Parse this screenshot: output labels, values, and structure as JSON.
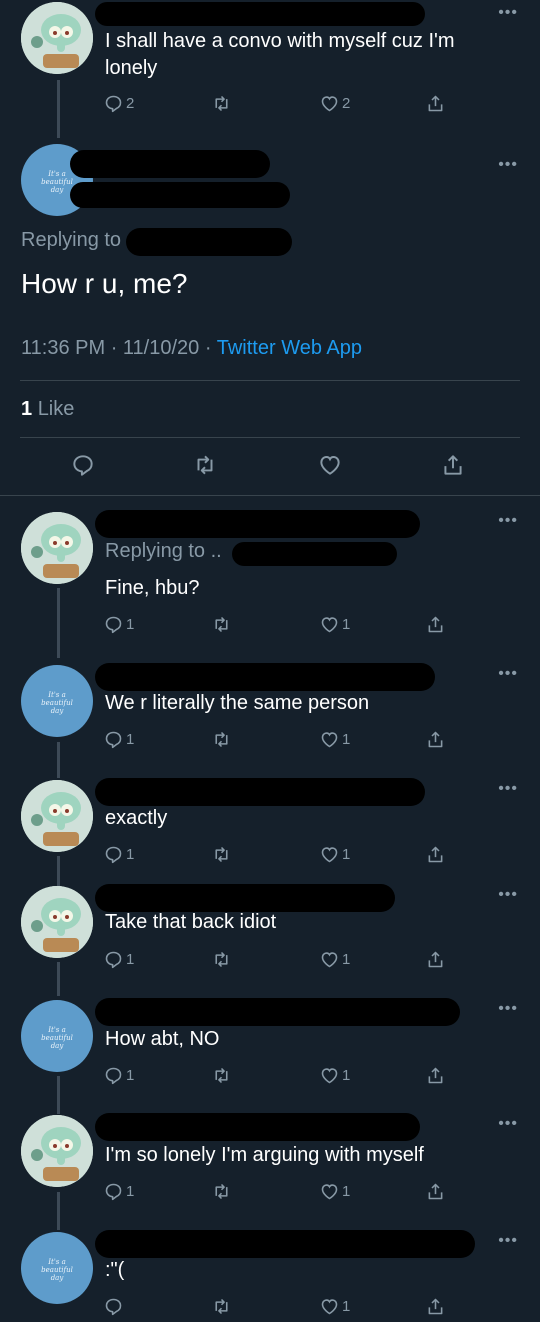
{
  "colors": {
    "background": "#15202b",
    "text": "#ffffff",
    "muted": "#8899a6",
    "link": "#1d9bf0",
    "divider": "#38444d"
  },
  "main_tweet": {
    "reply_label": "Replying to",
    "text": "How r u, me?",
    "time": "11:36 PM",
    "sep1": "·",
    "date": "11/10/20",
    "sep2": "·",
    "source": "Twitter Web App",
    "likes_count": "1",
    "likes_label": "Like"
  },
  "tweets": [
    {
      "text": "I shall have a convo with myself cuz I'm lonely",
      "replies": "2",
      "retweets": "",
      "likes": "2",
      "avatar": "squidward-avatar"
    },
    {
      "reply_label": "Replying to ..",
      "text": "Fine, hbu?",
      "replies": "1",
      "retweets": "",
      "likes": "1",
      "avatar": "squidward-avatar"
    },
    {
      "text": "We r literally the same person",
      "replies": "1",
      "retweets": "",
      "likes": "1",
      "avatar": "blue-avatar"
    },
    {
      "text": "exactly",
      "replies": "1",
      "retweets": "",
      "likes": "1",
      "avatar": "squidward-avatar"
    },
    {
      "text": "Take that back idiot",
      "replies": "1",
      "retweets": "",
      "likes": "1",
      "avatar": "squidward-avatar"
    },
    {
      "text": "How abt, NO",
      "replies": "1",
      "retweets": "",
      "likes": "1",
      "avatar": "blue-avatar"
    },
    {
      "text": "I'm so lonely I'm arguing with myself",
      "replies": "1",
      "retweets": "",
      "likes": "1",
      "avatar": "squidward-avatar"
    },
    {
      "text": ":\"(",
      "replies": "",
      "retweets": "",
      "likes": "1",
      "avatar": "blue-avatar"
    }
  ],
  "avatar_caption": [
    "It's a",
    "beautiful",
    "day"
  ],
  "more_label": "•••",
  "icons": [
    "reply-icon",
    "retweet-icon",
    "like-icon",
    "share-icon",
    "more-icon"
  ]
}
